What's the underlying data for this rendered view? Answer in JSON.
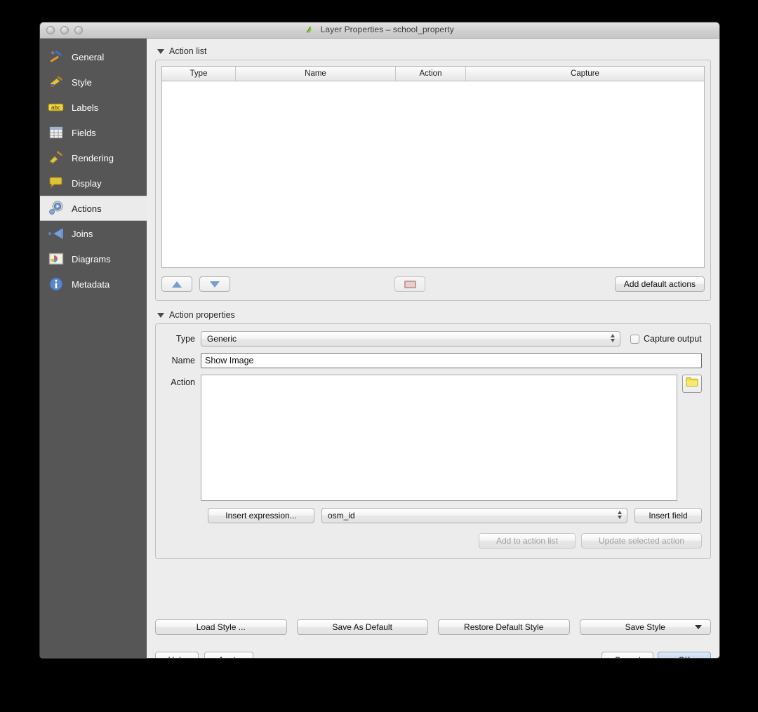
{
  "window": {
    "title": "Layer Properties – school_property",
    "title_icon": "qgis-leaf-icon",
    "controls": {
      "close": "close-button",
      "minimize": "minimize-button",
      "maximize": "maximize-button"
    }
  },
  "sidebar": {
    "items": [
      {
        "label": "General",
        "icon": "hammer-wrench-icon",
        "selected": false
      },
      {
        "label": "Style",
        "icon": "paintbrush-icon",
        "selected": false
      },
      {
        "label": "Labels",
        "icon": "abc-label-icon",
        "selected": false
      },
      {
        "label": "Fields",
        "icon": "table-grid-icon",
        "selected": false
      },
      {
        "label": "Rendering",
        "icon": "broom-icon",
        "selected": false
      },
      {
        "label": "Display",
        "icon": "speech-bubble-icon",
        "selected": false
      },
      {
        "label": "Actions",
        "icon": "gear-play-icon",
        "selected": true
      },
      {
        "label": "Joins",
        "icon": "join-arrow-icon",
        "selected": false
      },
      {
        "label": "Diagrams",
        "icon": "chart-picture-icon",
        "selected": false
      },
      {
        "label": "Metadata",
        "icon": "info-circle-icon",
        "selected": false
      }
    ]
  },
  "action_list": {
    "section_title": "Action list",
    "columns": [
      "Type",
      "Name",
      "Action",
      "Capture"
    ],
    "rows": [],
    "toolbar": {
      "move_up": "move-up-arrow",
      "move_down": "move-down-arrow",
      "remove": "remove-action-icon",
      "add_default_label": "Add default actions"
    }
  },
  "action_properties": {
    "section_title": "Action properties",
    "type_label": "Type",
    "type_value": "Generic",
    "capture_output_label": "Capture output",
    "capture_output_checked": false,
    "name_label": "Name",
    "name_value": "Show Image",
    "action_label": "Action",
    "action_value": "",
    "browse_icon": "folder-icon",
    "insert_expression_label": "Insert expression...",
    "field_value": "osm_id",
    "insert_field_label": "Insert field",
    "add_to_action_list_label": "Add to action list",
    "update_selected_action_label": "Update selected action"
  },
  "style_bar": {
    "load_style": "Load Style ...",
    "save_as_default": "Save As Default",
    "restore_default_style": "Restore Default Style",
    "save_style": "Save Style"
  },
  "bottom_bar": {
    "help": "Help",
    "apply": "Apply",
    "cancel": "Cancel",
    "ok": "OK"
  },
  "colors": {
    "sidebar_bg": "#565656",
    "window_bg": "#ededed",
    "selected_item_bg": "#ebebeb",
    "accent_blue": "#7b9bd4",
    "default_button_blue": "#b3cbe9"
  }
}
